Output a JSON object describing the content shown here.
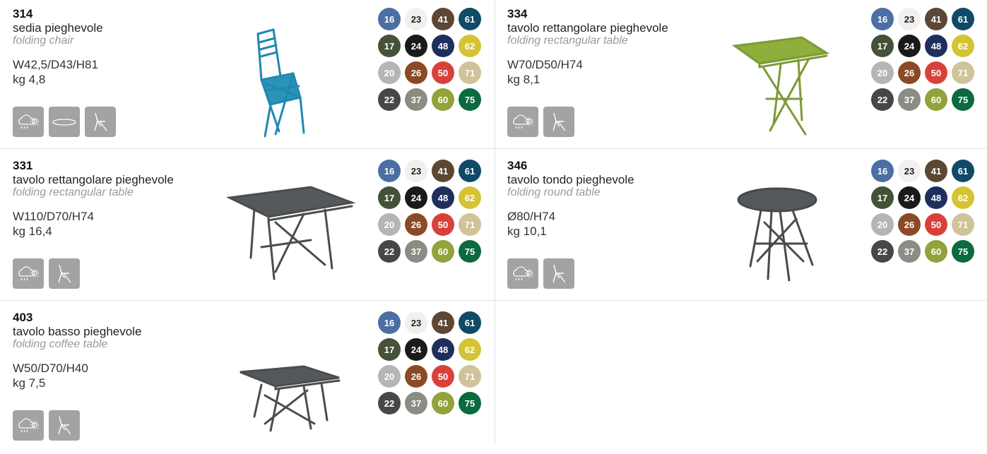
{
  "colors": [
    {
      "code": "16",
      "hex": "#4b6ea3"
    },
    {
      "code": "23",
      "hex": "#f1f0ee"
    },
    {
      "code": "41",
      "hex": "#5b4733"
    },
    {
      "code": "61",
      "hex": "#0f4a66"
    },
    {
      "code": "17",
      "hex": "#445238"
    },
    {
      "code": "24",
      "hex": "#1a1a1a"
    },
    {
      "code": "48",
      "hex": "#1e2f5d"
    },
    {
      "code": "62",
      "hex": "#d4c433"
    },
    {
      "code": "20",
      "hex": "#b5b5b5"
    },
    {
      "code": "26",
      "hex": "#8a4a26"
    },
    {
      "code": "50",
      "hex": "#d8413a"
    },
    {
      "code": "71",
      "hex": "#cfc399"
    },
    {
      "code": "22",
      "hex": "#474747"
    },
    {
      "code": "37",
      "hex": "#8b8c84"
    },
    {
      "code": "60",
      "hex": "#93a23a"
    },
    {
      "code": "75",
      "hex": "#0b6a3f"
    }
  ],
  "icons": [
    "weather-icon",
    "seat-pad-icon",
    "folding-icon"
  ],
  "products": [
    {
      "code": "314",
      "name_it": "sedia pieghevole",
      "name_en": "folding chair",
      "dimensions": "W42,5/D43/H81",
      "weight": "kg 4,8",
      "icons": [
        "weather-icon",
        "seat-pad-icon",
        "folding-icon"
      ],
      "photo": "blue-folding-chair"
    },
    {
      "code": "334",
      "name_it": "tavolo rettangolare pieghevole",
      "name_en": "folding rectangular table",
      "dimensions": "W70/D50/H74",
      "weight": "kg 8,1",
      "icons": [
        "weather-icon",
        "folding-icon"
      ],
      "photo": "green-rectangular-table"
    },
    {
      "code": "331",
      "name_it": "tavolo rettangolare pieghevole",
      "name_en": "folding rectangular table",
      "dimensions": "W110/D70/H74",
      "weight": "kg 16,4",
      "icons": [
        "weather-icon",
        "folding-icon"
      ],
      "photo": "grey-rectangular-table"
    },
    {
      "code": "346",
      "name_it": "tavolo tondo pieghevole",
      "name_en": "folding round table",
      "dimensions": "Ø80/H74",
      "weight": "kg 10,1",
      "icons": [
        "weather-icon",
        "folding-icon"
      ],
      "photo": "grey-round-table"
    },
    {
      "code": "403",
      "name_it": "tavolo basso pieghevole",
      "name_en": "folding coffee table",
      "dimensions": "W50/D70/H40",
      "weight": "kg 7,5",
      "icons": [
        "weather-icon",
        "folding-icon"
      ],
      "photo": "grey-coffee-table"
    }
  ]
}
